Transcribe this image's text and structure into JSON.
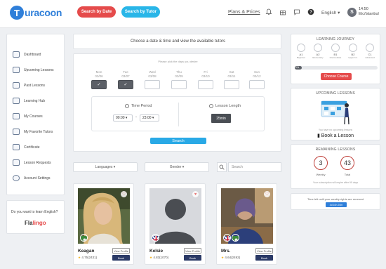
{
  "header": {
    "logo_letter": "T",
    "logo_text": "uracoon",
    "search_by_date": "Search by Date",
    "search_by_tutor": "Search by Tutor",
    "plans_prices": "Plans & Prices",
    "language": "English ▾",
    "avatar_initial": "S",
    "time": "14:50",
    "timezone": "Etc/Istanbul",
    "icons": [
      "bell-icon",
      "gift-icon",
      "chat-icon",
      "help-icon"
    ]
  },
  "sidebar": {
    "items": [
      {
        "label": "Dashboard"
      },
      {
        "label": "Upcoming Lessons"
      },
      {
        "label": "Past Lessons"
      },
      {
        "label": "Learning Hub"
      },
      {
        "label": "My Courses"
      },
      {
        "label": "My Favorite Tutors"
      },
      {
        "label": "Certificate"
      },
      {
        "label": "Lesson Requests"
      },
      {
        "label": "Account Settings"
      }
    ]
  },
  "promo": {
    "question": "Do you want to learn English?",
    "brand_a": "Fla",
    "brand_b": "lingo"
  },
  "picker": {
    "title": "Choose a date & time and view the available tutors",
    "hint": "Please pick the days you desire",
    "days": [
      {
        "name": "Mon",
        "date": "03/06",
        "selected": true
      },
      {
        "name": "Tue",
        "date": "03/07",
        "selected": true
      },
      {
        "name": "Wed",
        "date": "03/08",
        "selected": false
      },
      {
        "name": "Thu",
        "date": "03/09",
        "selected": false
      },
      {
        "name": "Fri",
        "date": "03/10",
        "selected": false
      },
      {
        "name": "Sat",
        "date": "03/11",
        "selected": false
      },
      {
        "name": "Sun",
        "date": "03/12",
        "selected": false
      }
    ],
    "check": "✓",
    "time_period_label": "Time Period",
    "time_from": "00:00",
    "time_to": "23:00",
    "time_sep": "-",
    "lesson_length_label": "Lesson Length",
    "lesson_length": "25min",
    "search_label": "Search"
  },
  "filters": {
    "languages": "Languages ▾",
    "gender": "Gender ▾",
    "search_placeholder": "Search"
  },
  "tutors": [
    {
      "name": "Keagan",
      "rating": "4.75(2431)",
      "view": "View Profile",
      "book": "Book"
    },
    {
      "name": "Kelsie",
      "rating": "4.83(1070)",
      "view": "View Profile",
      "book": "Book"
    },
    {
      "name": "Mrs.",
      "rating": "4.64(2492)",
      "view": "View Profile",
      "book": "Book"
    }
  ],
  "journey": {
    "title": "LEARNING JOURNEY",
    "levels": [
      {
        "code": "A1",
        "name": "Beginner"
      },
      {
        "code": "A2",
        "name": "Elementary"
      },
      {
        "code": "B1",
        "name": "Intermediate"
      },
      {
        "code": "B2",
        "name": "Upper Int."
      },
      {
        "code": "C1",
        "name": "Advanced"
      }
    ],
    "progress_label": "0%",
    "choose_course": "Choose Course"
  },
  "upcoming": {
    "title": "UPCOMING LESSONS",
    "empty_text": "You have no upcoming lessons",
    "book_lesson": "Book a Lesson"
  },
  "remaining": {
    "title": "REMAINING LESSONS",
    "weekly_value": "3",
    "weekly_label": "Weekly",
    "total_value": "43",
    "total_label": "Total",
    "expire_text": "Your subscription will expire after 99 days"
  },
  "weekly_rights": {
    "text": "Time left until your weekly rights are renewed",
    "countdown": "4d 10h 20m"
  }
}
